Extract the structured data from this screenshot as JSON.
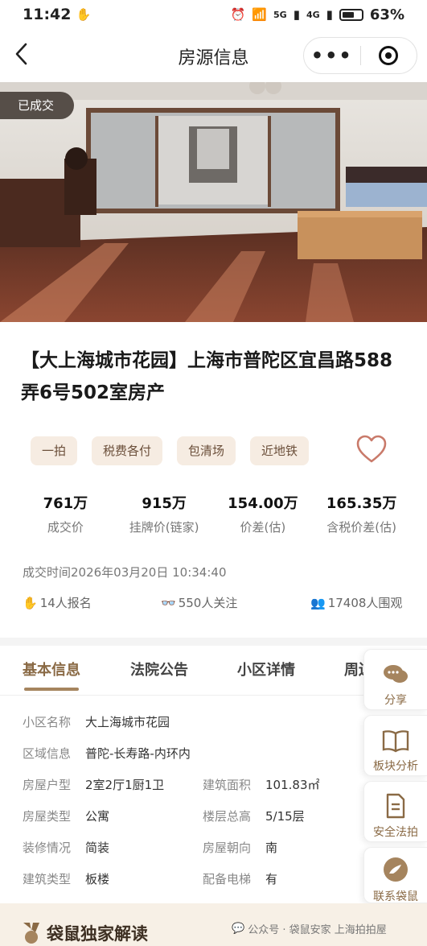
{
  "status_bar": {
    "time": "11:42",
    "network1": "5G",
    "network2": "4G",
    "battery": "63%",
    "battery_level": 0.63
  },
  "nav": {
    "title": "房源信息",
    "more": "•••"
  },
  "photo": {
    "badge": "已成交"
  },
  "title": "【大上海城市花园】上海市普陀区宜昌路588弄6号502室房产",
  "tags": [
    "一拍",
    "税费各付",
    "包清场",
    "近地铁"
  ],
  "stats": [
    {
      "value": "761万",
      "label": "成交价"
    },
    {
      "value": "915万",
      "label": "挂牌价(链家)"
    },
    {
      "value": "154.00万",
      "label": "价差(估)"
    },
    {
      "value": "165.35万",
      "label": "含税价差(估)"
    }
  ],
  "deal_time": "成交时间2026年03月20日 10:34:40",
  "metrics": {
    "signup": "14人报名",
    "follow": "550人关注",
    "watch": "17408人围观"
  },
  "tabs": [
    "基本信息",
    "法院公告",
    "小区详情",
    "周边"
  ],
  "basic_info": {
    "community": {
      "label": "小区名称",
      "value": "大上海城市花园"
    },
    "area": {
      "label": "区域信息",
      "value": "普陀-长寿路-内环内"
    },
    "layout": {
      "label": "房屋户型",
      "value": "2室2厅1厨1卫"
    },
    "size": {
      "label": "建筑面积",
      "value": "101.83㎡"
    },
    "type": {
      "label": "房屋类型",
      "value": "公寓"
    },
    "floor": {
      "label": "楼层总高",
      "value": "5/15层"
    },
    "decor": {
      "label": "装修情况",
      "value": "简装"
    },
    "orientation": {
      "label": "房屋朝向",
      "value": "南"
    },
    "building": {
      "label": "建筑类型",
      "value": "板楼"
    },
    "elevator": {
      "label": "配备电梯",
      "value": "有"
    }
  },
  "side_actions": [
    "分享",
    "板块分析",
    "安全法拍",
    "联系袋鼠"
  ],
  "bottom": {
    "title": "袋鼠独家解读",
    "watermark": "公众号 · 袋鼠安家 上海拍拍屋"
  },
  "colors": {
    "accent": "#a5845e",
    "tag_bg": "#f6ece2",
    "heart": "#c97a6a"
  }
}
